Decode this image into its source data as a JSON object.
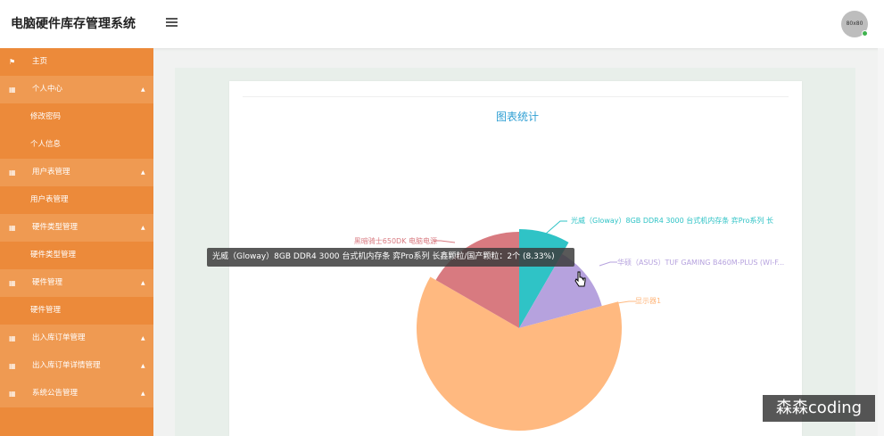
{
  "app": {
    "title": "电脑硬件库存管理系统",
    "avatar_text": "80x80"
  },
  "sidebar": {
    "items": [
      {
        "label": "主页",
        "kind": "top",
        "icon": "flag-icon"
      },
      {
        "label": "个人中心",
        "kind": "group",
        "icon": "grid-icon"
      },
      {
        "label": "修改密码",
        "kind": "sub"
      },
      {
        "label": "个人信息",
        "kind": "sub"
      },
      {
        "label": "用户表管理",
        "kind": "group",
        "icon": "grid-icon"
      },
      {
        "label": "用户表管理",
        "kind": "sub"
      },
      {
        "label": "硬件类型管理",
        "kind": "group",
        "icon": "grid-icon"
      },
      {
        "label": "硬件类型管理",
        "kind": "sub"
      },
      {
        "label": "硬件管理",
        "kind": "group",
        "icon": "grid-icon"
      },
      {
        "label": "硬件管理",
        "kind": "sub"
      },
      {
        "label": "出入库订单管理",
        "kind": "group",
        "icon": "grid-icon"
      },
      {
        "label": "出入库订单详情管理",
        "kind": "group",
        "icon": "grid-icon"
      },
      {
        "label": "系统公告管理",
        "kind": "group",
        "icon": "grid-icon"
      }
    ]
  },
  "main": {
    "chart_title": "图表统计",
    "tooltip": "光威（Gloway）8GB DDR4 3000 台式机内存条 弈Pro系列 长鑫颗粒/国产颗粒：2个 (8.33%)",
    "watermark": "森森coding"
  },
  "chart_data": {
    "type": "pie",
    "title": "图表统计",
    "series": [
      {
        "name": "光威（Gloway）8GB DDR4 3000 台式机内存条 弈Pro系列 长",
        "value": 2,
        "percent": 8.33,
        "color": "#2fc3c6"
      },
      {
        "name": "华硕（ASUS）TUF GAMING B460M-PLUS (WI-F...",
        "value": 3,
        "percent": 12.5,
        "color": "#b6a2de"
      },
      {
        "name": "显示器1",
        "value": 15,
        "percent": 62.5,
        "color": "#ffb980"
      },
      {
        "name": "黑暗骑士650DK 电脑电源",
        "value": 4,
        "percent": 16.67,
        "color": "#d87a80"
      }
    ]
  },
  "colors": {
    "sidebar": "#ec8a3a",
    "sidebar_group": "#ef9a52",
    "accent": "#2f9fd3"
  }
}
